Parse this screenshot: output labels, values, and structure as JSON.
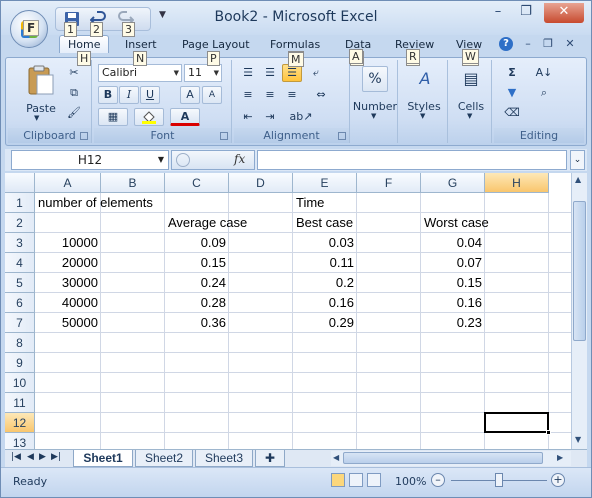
{
  "window": {
    "title": "Book2 - Microsoft Excel",
    "minimize": "–",
    "restore": "❐",
    "close": "✕",
    "ribbon_minimize": "–",
    "ribbon_restore": "❐",
    "ribbon_close": "✕"
  },
  "office_button": {
    "keytip": "F"
  },
  "qat": {
    "keytips": [
      "1",
      "2",
      "3"
    ]
  },
  "tabs": [
    {
      "label": "Home",
      "keytip": "H"
    },
    {
      "label": "Insert",
      "keytip": "N"
    },
    {
      "label": "Page Layout",
      "keytip": "P"
    },
    {
      "label": "Formulas",
      "keytip": "M"
    },
    {
      "label": "Data",
      "keytip": "A"
    },
    {
      "label": "Review",
      "keytip": "R"
    },
    {
      "label": "View",
      "keytip": "W"
    }
  ],
  "help": "?",
  "ribbon": {
    "clipboard": {
      "label": "Clipboard",
      "paste": "Paste"
    },
    "font": {
      "label": "Font",
      "name": "Calibri",
      "size": "11",
      "bold": "B",
      "italic": "I",
      "underline": "U",
      "grow": "A",
      "shrink": "A",
      "color": "A"
    },
    "alignment": {
      "label": "Alignment"
    },
    "number": {
      "label": "Number",
      "symbol": "%"
    },
    "styles": {
      "label": "Styles",
      "symbol": "A"
    },
    "cells": {
      "label": "Cells"
    },
    "editing": {
      "label": "Editing",
      "sum": "Σ"
    }
  },
  "formula_bar": {
    "name_box": "H12",
    "fx": "fx",
    "content": ""
  },
  "grid": {
    "columns": [
      "A",
      "B",
      "C",
      "D",
      "E",
      "F",
      "G",
      "H"
    ],
    "rows": [
      "1",
      "2",
      "3",
      "4",
      "5",
      "6",
      "7",
      "8",
      "9",
      "10",
      "11",
      "12",
      "13"
    ],
    "selected_cell": "H12",
    "cells": {
      "A1": "number of elements",
      "E1": "Time",
      "C2": "Average case",
      "E2": "Best case",
      "G2": "Worst case",
      "A3": "10000",
      "C3": "0.09",
      "E3": "0.03",
      "G3": "0.04",
      "A4": "20000",
      "C4": "0.15",
      "E4": "0.11",
      "G4": "0.07",
      "A5": "30000",
      "C5": "0.24",
      "E5": "0.2",
      "G5": "0.15",
      "A6": "40000",
      "C6": "0.28",
      "E6": "0.16",
      "G6": "0.16",
      "A7": "50000",
      "C7": "0.36",
      "E7": "0.29",
      "G7": "0.23"
    }
  },
  "sheet_tabs": [
    "Sheet1",
    "Sheet2",
    "Sheet3"
  ],
  "active_sheet": "Sheet1",
  "status": {
    "text": "Ready",
    "zoom": "100%",
    "zoom_out": "–",
    "zoom_in": "+"
  },
  "colors": {
    "accent": "#c5d8ef",
    "selection_header": "#f9c66d"
  }
}
